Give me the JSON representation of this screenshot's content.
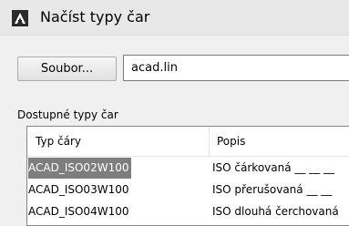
{
  "window": {
    "title": "Načíst typy čar",
    "icon": "acad-logo-icon"
  },
  "file": {
    "button_label": "Soubor...",
    "path_value": "acad.lin"
  },
  "group": {
    "label": "Dostupné typy čar"
  },
  "table": {
    "columns": [
      "Typ čáry",
      "Popis"
    ],
    "rows": [
      {
        "type": "ACAD_ISO02W100",
        "desc": "ISO čárkovaná __ __ __",
        "selected": true
      },
      {
        "type": "ACAD_ISO03W100",
        "desc": "ISO přerušovaná __ __",
        "selected": false
      },
      {
        "type": "ACAD_ISO04W100",
        "desc": "ISO dlouhá čerchovaná",
        "selected": false
      }
    ]
  },
  "colors": {
    "selection": "#7e7e7e",
    "window_bg": "#f0f0f0"
  }
}
